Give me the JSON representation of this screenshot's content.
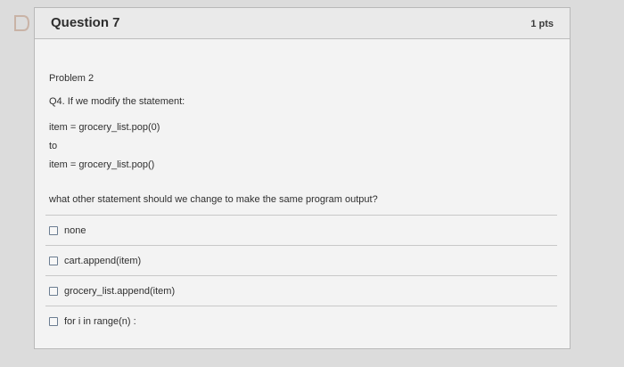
{
  "question": {
    "title": "Question 7",
    "points": "1 pts",
    "problem": "Problem 2",
    "prompt": "Q4. If we modify the statement:",
    "code_before": "item = grocery_list.pop(0)",
    "connector": "to",
    "code_after": "item = grocery_list.pop()",
    "ask": "what other statement should we change to make the same program output?"
  },
  "answers": [
    {
      "label": "none"
    },
    {
      "label": "cart.append(item)"
    },
    {
      "label": "grocery_list.append(item)"
    },
    {
      "label": "for i in range(n) :"
    }
  ]
}
